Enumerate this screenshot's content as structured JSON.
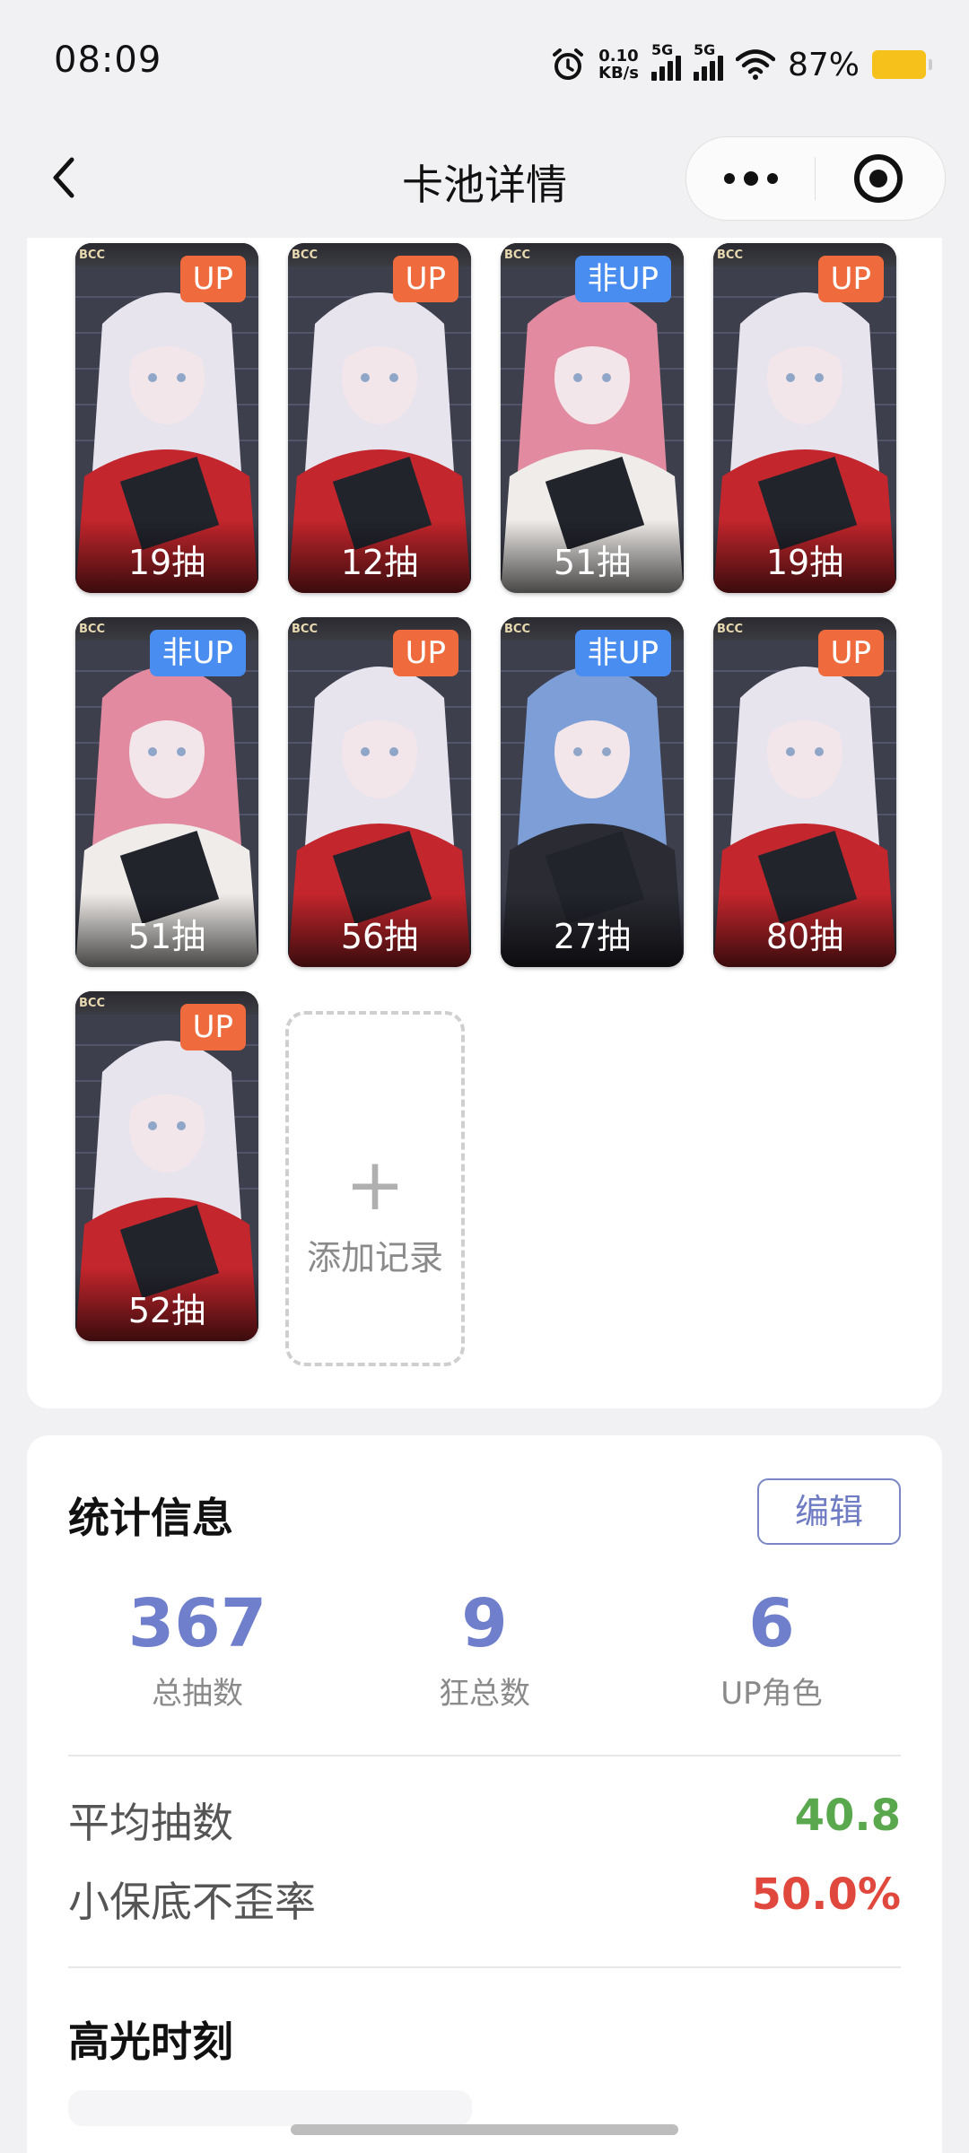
{
  "status_bar": {
    "time": "08:09",
    "net_speed_value": "0.10",
    "net_speed_unit": "KB/s",
    "signal1_label": "5G",
    "signal2_label": "5G",
    "battery_percent": "87%",
    "icons": [
      "alarm-icon",
      "signal-icon",
      "wifi-icon",
      "battery-icon"
    ]
  },
  "nav": {
    "title": "卡池详情",
    "icons": [
      "back-arrow-icon",
      "more-dots-icon",
      "target-icon"
    ]
  },
  "cards": [
    {
      "badge": "UP",
      "pulls": "19抽",
      "type": "up",
      "character": "white-hair-red-coat",
      "banner": "BCC"
    },
    {
      "badge": "UP",
      "pulls": "12抽",
      "type": "up",
      "character": "white-hair-red-coat",
      "banner": "BCC"
    },
    {
      "badge": "非UP",
      "pulls": "51抽",
      "type": "nonup",
      "character": "pink-hair-glasses",
      "banner": "BCC"
    },
    {
      "badge": "UP",
      "pulls": "19抽",
      "type": "up",
      "character": "white-hair-red-coat",
      "banner": "BCC"
    },
    {
      "badge": "非UP",
      "pulls": "51抽",
      "type": "nonup",
      "character": "pink-hair-glasses",
      "banner": "BCC"
    },
    {
      "badge": "UP",
      "pulls": "56抽",
      "type": "up",
      "character": "white-hair-red-coat",
      "banner": "BCC"
    },
    {
      "badge": "非UP",
      "pulls": "27抽",
      "type": "nonup",
      "character": "blue-hair",
      "banner": "BCC"
    },
    {
      "badge": "UP",
      "pulls": "80抽",
      "type": "up",
      "character": "white-hair-red-coat",
      "banner": "BCC"
    },
    {
      "badge": "UP",
      "pulls": "52抽",
      "type": "up",
      "character": "white-hair-red-coat",
      "banner": "BCC"
    }
  ],
  "add_record": {
    "label": "添加记录",
    "icon": "plus-icon"
  },
  "stats": {
    "title": "统计信息",
    "edit_label": "编辑",
    "total_pulls": {
      "value": "367",
      "label": "总抽数"
    },
    "total_crazy": {
      "value": "9",
      "label": "狂总数"
    },
    "up_chars": {
      "value": "6",
      "label": "UP角色"
    },
    "avg_pulls": {
      "label": "平均抽数",
      "value": "40.8"
    },
    "no_lose_rate": {
      "label": "小保底不歪率",
      "value": "50.0%"
    },
    "highlight_title": "高光时刻"
  },
  "colors": {
    "accent": "#6f7fcb",
    "up_badge": "#ef6a3c",
    "nonup_badge": "#4a8df0",
    "avg_value": "#5aa84e",
    "rate_value": "#e0483e"
  }
}
